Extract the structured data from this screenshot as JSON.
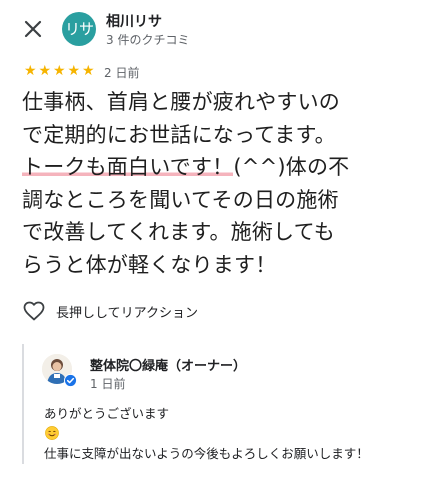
{
  "header": {
    "close_icon": "close-icon",
    "avatar_text": "リサ",
    "reviewer_name": "相川リサ",
    "reviewer_meta": "3 件のクチコミ"
  },
  "rating": {
    "stars": 5,
    "max_stars": 5,
    "star_color": "#f6b400",
    "date": "2 日前"
  },
  "review": {
    "lines": [
      "仕事柄、首肩と腰が疲れやすいの",
      "で定期的にお世話になってます。",
      "トークも面白いです！",
      "(^^)体の不",
      "調なところを聞いてその日の施術",
      "で改善してくれます。施術しても",
      "らうと体が軽くなります！"
    ],
    "highlight_color": "#f5b3bc"
  },
  "reaction": {
    "icon": "heart-outline-icon",
    "label": "長押ししてリアクション"
  },
  "owner_reply": {
    "owner_name": "整体院〇緑庵（オーナー）",
    "date": "1 日前",
    "line1": "ありがとうございます",
    "emoji": "smiling-face-emoji",
    "line2": "仕事に支障が出ないようの今後もよろしくお願いします！"
  },
  "colors": {
    "avatar_bg": "#2a9fa0",
    "divider": "#dadce0",
    "verified_badge": "#1a73e8"
  }
}
